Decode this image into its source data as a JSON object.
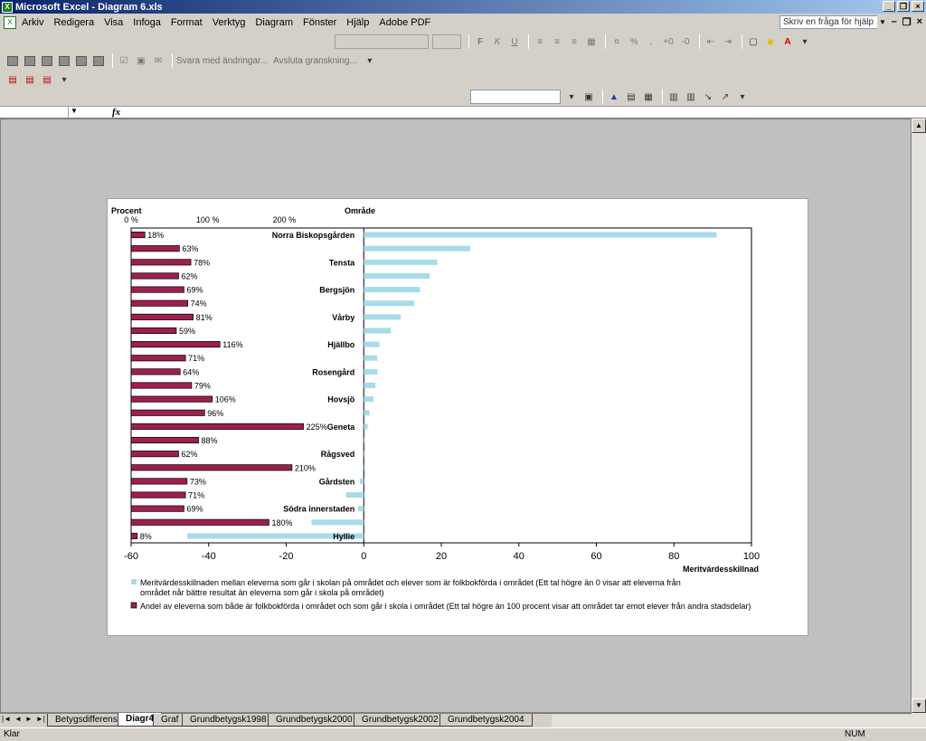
{
  "window": {
    "title": "Microsoft Excel - Diagram 6.xls"
  },
  "menu": [
    "Arkiv",
    "Redigera",
    "Visa",
    "Infoga",
    "Format",
    "Verktyg",
    "Diagram",
    "Fönster",
    "Hjälp",
    "Adobe PDF"
  ],
  "help": {
    "placeholder": "Skriv en fråga för hjälp"
  },
  "review_toolbar": {
    "reply_label": "Svara med ändringar...",
    "end_review_label": "Avsluta granskning..."
  },
  "formula_bar": {
    "fx": "fx"
  },
  "chart_data": {
    "type": "bar",
    "title_left": "Procent",
    "title_right": "Område",
    "categories": [
      "Norra Biskopsgården",
      "",
      "Tensta",
      "",
      "Bergsjön",
      "",
      "Vårby",
      "",
      "Hjällbo",
      "",
      "Rosengård",
      "",
      "Hovsjö",
      "",
      "Geneta",
      "",
      "Rågsved",
      "",
      "Gårdsten",
      "",
      "Södra innerstaden",
      "",
      "Hyllie"
    ],
    "series": [
      {
        "name": "Andel av eleverna som både är folkbokförda i området och som går i skola i området (Ett tal högre än 100 procent visar att området tar emot elever från andra stadsdelar)",
        "color": "#9c1f4f",
        "values": [
          18,
          63,
          78,
          62,
          69,
          74,
          81,
          59,
          116,
          71,
          64,
          79,
          106,
          96,
          225,
          88,
          62,
          210,
          73,
          71,
          69,
          180,
          8
        ],
        "labels": [
          "18%",
          "63%",
          "78%",
          "62%",
          "69%",
          "74%",
          "81%",
          "59%",
          "116%",
          "71%",
          "64%",
          "79%",
          "106%",
          "96%",
          "225%",
          "88%",
          "62%",
          "210%",
          "73%",
          "71%",
          "69%",
          "180%",
          "8%"
        ],
        "axis": {
          "ticks": [
            "0 %",
            "100 %",
            "200 %"
          ]
        }
      },
      {
        "name": "Meritvärdesskillnaden mellan eleverna som går i skolan på området och elever som är folkbokförda i området (Ett tal högre än 0 visar att eleverna från området når bättre resultat än eleverna som går i skola på området)",
        "color": "#a8dbe8",
        "values": [
          91,
          27.5,
          19,
          17,
          14.5,
          13,
          9.5,
          7,
          4,
          3.5,
          3.5,
          3,
          2.5,
          1.5,
          1,
          0.3,
          0.3,
          -0.3,
          -1,
          -4.5,
          -1.5,
          -13.5,
          -45.5
        ],
        "axis": {
          "min": -60,
          "max": 100,
          "ticks": [
            "-60",
            "-40",
            "-20",
            "0",
            "20",
            "40",
            "60",
            "80",
            "100"
          ],
          "label": "Meritvärdesskillnad"
        }
      }
    ],
    "legend_position": "bottom",
    "grid": false
  },
  "sheet_tabs": [
    "Betygsdifferens",
    "Diagr4",
    "Graf",
    "Grundbetygsk1998",
    "Grundbetygsk2000",
    "Grundbetygsk2002",
    "Grundbetygsk2004"
  ],
  "active_tab": "Diagr4",
  "status": {
    "ready": "Klar",
    "num": "NUM"
  }
}
